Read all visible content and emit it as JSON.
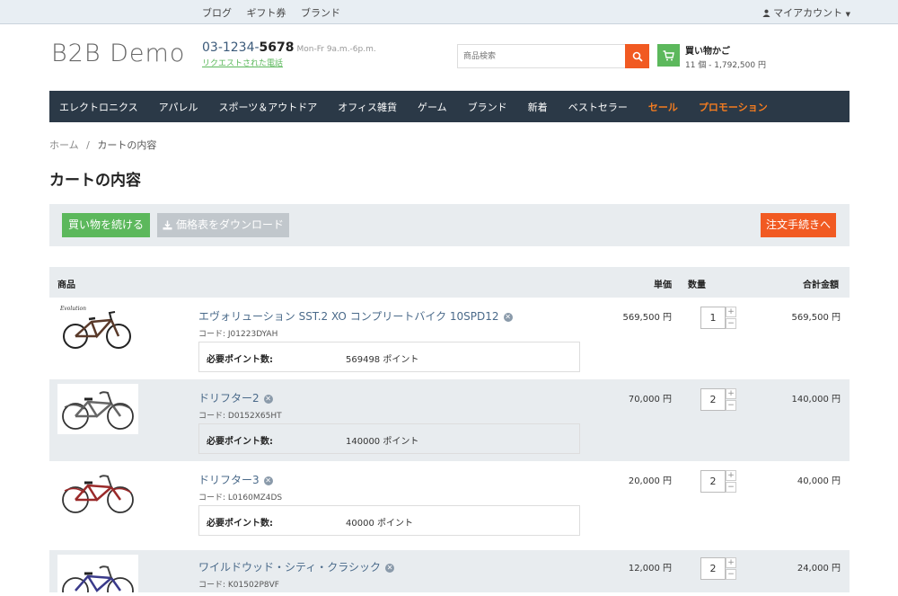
{
  "topbar": {
    "links": [
      "ブログ",
      "ギフト券",
      "ブランド"
    ],
    "account": "マイアカウント"
  },
  "header": {
    "logo": "B2B Demo",
    "phone_prefix": "03-1234-",
    "phone_suffix": "5678",
    "hours": "Mon-Fr 9a.m.-6p.m.",
    "request_link": "リクエストされた電話",
    "search_placeholder": "商品検索",
    "cart_title": "買い物かご",
    "cart_summary": "11 個 - 1,792,500 円"
  },
  "nav": {
    "items": [
      "エレクトロニクス",
      "アパレル",
      "スポーツ＆アウトドア",
      "オフィス雑貨",
      "ゲーム",
      "ブランド",
      "新着",
      "ベストセラー",
      "セール",
      "プロモーション"
    ]
  },
  "breadcrumb": {
    "home": "ホーム",
    "sep": "/",
    "current": "カートの内容"
  },
  "page_title": "カートの内容",
  "actions": {
    "continue": "買い物を続ける",
    "download": "価格表をダウンロード",
    "checkout": "注文手続きへ"
  },
  "table": {
    "headers": {
      "product": "商品",
      "unit_price": "単価",
      "qty": "数量",
      "total": "合計金額"
    },
    "points_label": "必要ポイント数:",
    "code_prefix": "コード: ",
    "rows": [
      {
        "name": "エヴォリューション SST.2 XO コンプリートバイク 10SPD12",
        "code": "J01223DYAH",
        "points": "569498 ポイント",
        "price": "569,500 円",
        "qty": "1",
        "total": "569,500 円"
      },
      {
        "name": "ドリフター2",
        "code": "D0152X65HT",
        "points": "140000 ポイント",
        "price": "70,000 円",
        "qty": "2",
        "total": "140,000 円"
      },
      {
        "name": "ドリフター3",
        "code": "L0160MZ4DS",
        "points": "40000 ポイント",
        "price": "20,000 円",
        "qty": "2",
        "total": "40,000 円"
      },
      {
        "name": "ワイルドウッド・シティ・クラシック",
        "code": "K01502P8VF",
        "points": "",
        "price": "12,000 円",
        "qty": "2",
        "total": "24,000 円"
      }
    ]
  },
  "colors": {
    "accent": "#f15a22",
    "green": "#5cb85c",
    "nav_bg": "#2b3947",
    "promo": "#f47c20"
  }
}
